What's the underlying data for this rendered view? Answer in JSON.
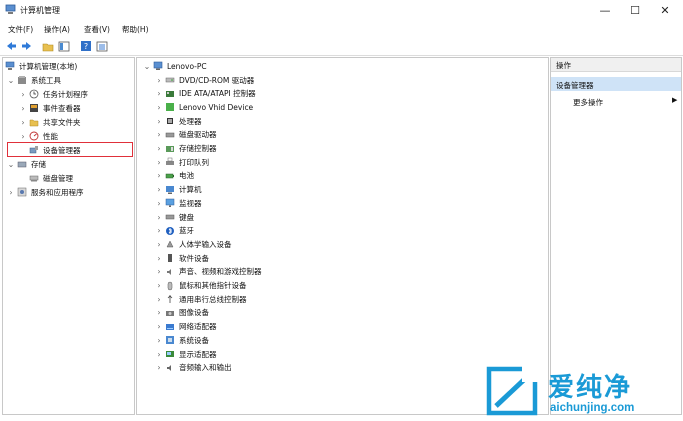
{
  "window": {
    "title": "计算机管理",
    "controls": {
      "minimize": "—",
      "maximize": "☐",
      "close": "✕"
    }
  },
  "menu": [
    "文件(F)",
    "操作(A)",
    "查看(V)",
    "帮助(H)"
  ],
  "left_tree": {
    "root": "计算机管理(本地)",
    "system_tools": "系统工具",
    "system_children": [
      "任务计划程序",
      "事件查看器",
      "共享文件夹",
      "性能",
      "设备管理器"
    ],
    "storage": "存储",
    "storage_children": [
      "磁盘管理"
    ],
    "services": "服务和应用程序"
  },
  "device_tree": {
    "computer": "Lenovo-PC",
    "categories": [
      {
        "label": "DVD/CD-ROM 驱动器",
        "icon": "disc-drive-icon"
      },
      {
        "label": "IDE ATA/ATAPI 控制器",
        "icon": "ide-controller-icon"
      },
      {
        "label": "Lenovo Vhid Device",
        "icon": "lenovo-device-icon"
      },
      {
        "label": "处理器",
        "icon": "processor-icon"
      },
      {
        "label": "磁盘驱动器",
        "icon": "disk-drive-icon"
      },
      {
        "label": "存储控制器",
        "icon": "storage-controller-icon"
      },
      {
        "label": "打印队列",
        "icon": "printer-icon"
      },
      {
        "label": "电池",
        "icon": "battery-icon"
      },
      {
        "label": "计算机",
        "icon": "computer-icon"
      },
      {
        "label": "监视器",
        "icon": "monitor-icon"
      },
      {
        "label": "键盘",
        "icon": "keyboard-icon"
      },
      {
        "label": "蓝牙",
        "icon": "bluetooth-icon"
      },
      {
        "label": "人体学输入设备",
        "icon": "hid-icon"
      },
      {
        "label": "软件设备",
        "icon": "software-device-icon"
      },
      {
        "label": "声音、视频和游戏控制器",
        "icon": "sound-icon"
      },
      {
        "label": "鼠标和其他指针设备",
        "icon": "mouse-icon"
      },
      {
        "label": "通用串行总线控制器",
        "icon": "usb-icon"
      },
      {
        "label": "图像设备",
        "icon": "camera-icon"
      },
      {
        "label": "网络适配器",
        "icon": "network-icon"
      },
      {
        "label": "系统设备",
        "icon": "system-device-icon"
      },
      {
        "label": "显示适配器",
        "icon": "display-adapter-icon"
      },
      {
        "label": "音频输入和输出",
        "icon": "audio-io-icon"
      }
    ]
  },
  "actions": {
    "header": "操作",
    "selected": "设备管理器",
    "more": "更多操作"
  },
  "watermark": {
    "text": "爱纯净",
    "url": "aichunjing.com"
  },
  "colors": {
    "highlight_border": "#e0303a",
    "selected_bg": "#cfe3f7",
    "brand_blue": "#1a9ad6"
  }
}
